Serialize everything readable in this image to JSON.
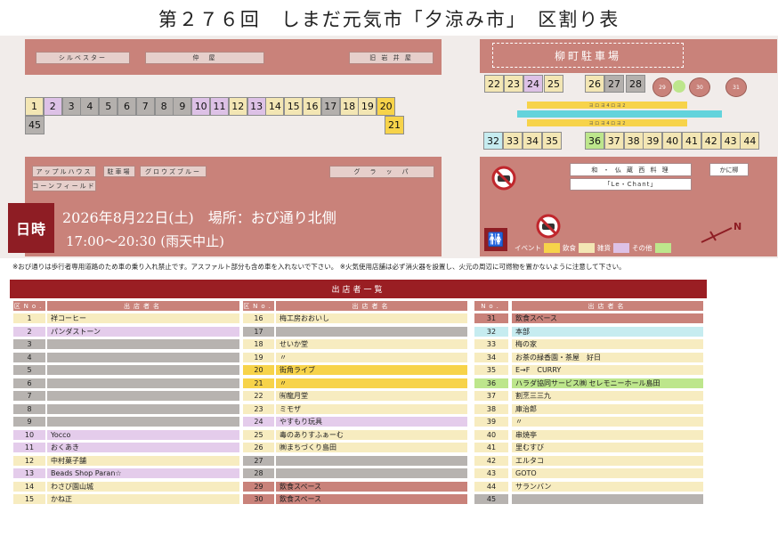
{
  "title": "第２７６回　しまだ元気市「夕涼み市」　区割り表",
  "map": {
    "top_labels": [
      "シルベスター",
      "仲　屋",
      "旧 岩 井 屋"
    ],
    "parking": "柳町駐車場",
    "left_labels": [
      "アップルハウス",
      "駐車場",
      "グロウズブルー",
      "コーンフィールド",
      "グ　ラ　ッ　パ"
    ],
    "right_labels": [
      "和 ・ 仏 蔵 西 料 理",
      "「Le・Chant」",
      "かに柳"
    ],
    "bar_labels": [
      "ヨ ロ ヨ 4 ロ ヨ 2",
      "ヨ ロ ヨ 4 ロ ヨ 2"
    ],
    "circles": [
      "29",
      "30",
      "31"
    ],
    "north": "N",
    "legend": [
      {
        "label": "イベント",
        "color": "#f7d34a"
      },
      {
        "label": "飲食",
        "color": "#f3e6b4"
      },
      {
        "label": "雑貨",
        "color": "#ddc1e6"
      },
      {
        "label": "その他",
        "color": "#bde68c"
      }
    ]
  },
  "date_label": "日時",
  "date_text": "2026年8月22日(土)　場所：おび通り北側",
  "time_text": "17:00〜20:30 (雨天中止)",
  "note": "※おび通りは歩行者専用道路のため車の乗り入れ禁止です。アスファルト部分も含め車を入れないで下さい。 ※火気使用店舗は必ず消火器を設置し、火元の周辺に可燃物を置かないように注意して下さい。",
  "list_title": "出店者一覧",
  "headers": {
    "left_no": "区No.",
    "mid_no": "区No.",
    "right_no": "No.",
    "name": "出店者名"
  },
  "stalls_row1": [
    "1",
    "2",
    "3",
    "4",
    "5",
    "6",
    "7",
    "8",
    "9",
    "10",
    "11",
    "12",
    "13",
    "14",
    "15",
    "16",
    "17",
    "18",
    "19",
    "20"
  ],
  "stalls_row1_cat": [
    "food",
    "misc",
    "gray",
    "gray",
    "gray",
    "gray",
    "gray",
    "gray",
    "gray",
    "misc",
    "misc",
    "food",
    "misc",
    "food",
    "food",
    "food",
    "gray",
    "food",
    "food",
    "event"
  ],
  "stalls_extra": [
    "45",
    "21"
  ],
  "stalls_right_top": [
    "22",
    "23",
    "24",
    "25",
    "26",
    "27",
    "28"
  ],
  "stalls_right_top_cat": [
    "food",
    "food",
    "misc",
    "food",
    "food",
    "gray",
    "gray"
  ],
  "stalls_right_bottom": [
    "32",
    "33",
    "34",
    "35",
    "36",
    "37",
    "38",
    "39",
    "40",
    "41",
    "42",
    "43",
    "44"
  ],
  "stalls_right_bottom_cat": [
    "hq",
    "food",
    "food",
    "food",
    "other",
    "food",
    "food",
    "food",
    "food",
    "food",
    "food",
    "food",
    "food"
  ],
  "list_col1": [
    {
      "no": "1",
      "name": "祥コーヒー",
      "cat": "food"
    },
    {
      "no": "2",
      "name": "パンダストーン",
      "cat": "misc"
    },
    {
      "no": "3",
      "name": "",
      "cat": "gray"
    },
    {
      "no": "4",
      "name": "",
      "cat": "gray"
    },
    {
      "no": "5",
      "name": "",
      "cat": "gray"
    },
    {
      "no": "6",
      "name": "",
      "cat": "gray"
    },
    {
      "no": "7",
      "name": "",
      "cat": "gray"
    },
    {
      "no": "8",
      "name": "",
      "cat": "gray"
    },
    {
      "no": "9",
      "name": "",
      "cat": "gray"
    },
    {
      "no": "10",
      "name": "Yocco",
      "cat": "misc"
    },
    {
      "no": "11",
      "name": "おくあき",
      "cat": "misc"
    },
    {
      "no": "12",
      "name": "中村菓子舗",
      "cat": "food"
    },
    {
      "no": "13",
      "name": "Beads Shop Paran☆",
      "cat": "misc"
    },
    {
      "no": "14",
      "name": "わさび園山城",
      "cat": "food"
    },
    {
      "no": "15",
      "name": "かね正",
      "cat": "food"
    }
  ],
  "list_col2": [
    {
      "no": "16",
      "name": "梅工房おおいし",
      "cat": "food"
    },
    {
      "no": "17",
      "name": "",
      "cat": "gray"
    },
    {
      "no": "18",
      "name": "せいか堂",
      "cat": "food"
    },
    {
      "no": "19",
      "name": "〃",
      "cat": "food"
    },
    {
      "no": "20",
      "name": "街角ライブ",
      "cat": "event"
    },
    {
      "no": "21",
      "name": "〃",
      "cat": "event"
    },
    {
      "no": "22",
      "name": "㈲龍月堂",
      "cat": "food"
    },
    {
      "no": "23",
      "name": "ミモザ",
      "cat": "food"
    },
    {
      "no": "24",
      "name": "やすもり玩具",
      "cat": "misc"
    },
    {
      "no": "25",
      "name": "毒のありすふぁーむ",
      "cat": "food"
    },
    {
      "no": "26",
      "name": "㈱まちづくり島田",
      "cat": "food"
    },
    {
      "no": "27",
      "name": "",
      "cat": "gray"
    },
    {
      "no": "28",
      "name": "",
      "cat": "gray"
    },
    {
      "no": "29",
      "name": "飲食スペース",
      "cat": "space"
    },
    {
      "no": "30",
      "name": "飲食スペース",
      "cat": "space"
    }
  ],
  "list_col3": [
    {
      "no": "31",
      "name": "飲食スペース",
      "cat": "space"
    },
    {
      "no": "32",
      "name": "本部",
      "cat": "hq"
    },
    {
      "no": "33",
      "name": "梅の家",
      "cat": "food"
    },
    {
      "no": "34",
      "name": "お茶の緑香園・茶屋　好日",
      "cat": "food"
    },
    {
      "no": "35",
      "name": "E→F　CURRY",
      "cat": "food"
    },
    {
      "no": "36",
      "name": "ハラダ協同サービス㈱ セレモニーホール島田",
      "cat": "other"
    },
    {
      "no": "37",
      "name": "割烹三三九",
      "cat": "food"
    },
    {
      "no": "38",
      "name": "庫治郎",
      "cat": "food"
    },
    {
      "no": "39",
      "name": "〃",
      "cat": "food"
    },
    {
      "no": "40",
      "name": "串焼亭",
      "cat": "food"
    },
    {
      "no": "41",
      "name": "里むすび",
      "cat": "food"
    },
    {
      "no": "42",
      "name": "エルタコ",
      "cat": "food"
    },
    {
      "no": "43",
      "name": "GOTO",
      "cat": "food"
    },
    {
      "no": "44",
      "name": "サランバン",
      "cat": "food"
    },
    {
      "no": "45",
      "name": "",
      "cat": "gray"
    }
  ]
}
